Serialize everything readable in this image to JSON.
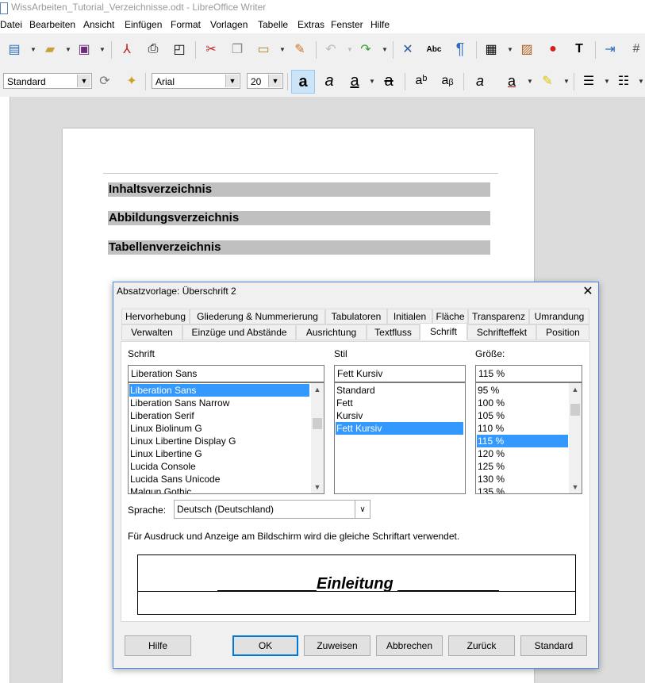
{
  "window": {
    "title": "WissArbeiten_Tutorial_Verzeichnisse.odt - LibreOffice Writer"
  },
  "menu": [
    "Datei",
    "Bearbeiten",
    "Ansicht",
    "Einfügen",
    "Format",
    "Vorlagen",
    "Tabelle",
    "Extras",
    "Fenster",
    "Hilfe"
  ],
  "formatting": {
    "paragraph_style": "Standard",
    "font_name": "Arial",
    "font_size": "20"
  },
  "document": {
    "headings": [
      "Inhaltsverzeichnis",
      "Abbildungsverzeichnis",
      "Tabellenverzeichnis"
    ]
  },
  "dialog": {
    "title": "Absatzvorlage: Überschrift 2",
    "close_glyph": "✕",
    "tabs_row1": [
      "Hervorhebung",
      "Gliederung & Nummerierung",
      "Tabulatoren",
      "Initialen",
      "Fläche",
      "Transparenz",
      "Umrandung"
    ],
    "tabs_row2": [
      "Verwalten",
      "Einzüge und Abstände",
      "Ausrichtung",
      "Textfluss",
      "Schrift",
      "Schrifteffekt",
      "Position"
    ],
    "selected_tab": "Schrift",
    "font": {
      "label": "Schrift",
      "value": "Liberation Sans",
      "options": [
        "Liberation Sans",
        "Liberation Sans Narrow",
        "Liberation Serif",
        "Linux Biolinum G",
        "Linux Libertine Display G",
        "Linux Libertine G",
        "Lucida Console",
        "Lucida Sans Unicode",
        "Malgun Gothic"
      ],
      "selected_index": 0
    },
    "style": {
      "label": "Stil",
      "value": "Fett Kursiv",
      "options": [
        "Standard",
        "Fett",
        "Kursiv",
        "Fett Kursiv"
      ],
      "selected_index": 3
    },
    "size": {
      "label": "Größe:",
      "value": "115 %",
      "options": [
        "95 %",
        "100 %",
        "105 %",
        "110 %",
        "115 %",
        "120 %",
        "125 %",
        "130 %",
        "135 %"
      ],
      "selected_index": 4
    },
    "language": {
      "label": "Sprache:",
      "value": "Deutsch (Deutschland)"
    },
    "info": "Für Ausdruck und Anzeige am Bildschirm wird die gleiche Schriftart verwendet.",
    "preview_text": "Einleitung",
    "buttons": {
      "help": "Hilfe",
      "ok": "OK",
      "apply": "Zuweisen",
      "cancel": "Abbrechen",
      "back": "Zurück",
      "standard": "Standard"
    }
  },
  "colors": {
    "accent": "#3399ff",
    "dialog_border": "#4a8ae0",
    "heading_bg": "#c0c0c0"
  }
}
